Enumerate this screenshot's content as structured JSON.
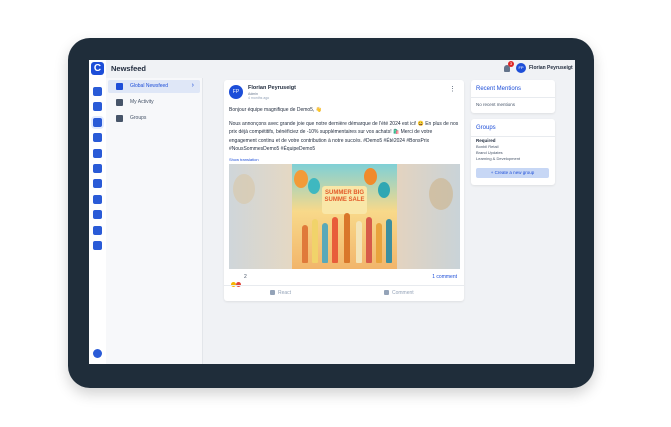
{
  "header": {
    "title": "Newsfeed",
    "notification_count": "3",
    "user_initials": "FP",
    "user_name": "Florian Peyruseigt"
  },
  "rail": {
    "logo": "C",
    "icons": [
      "home-icon",
      "chart-icon",
      "activity-icon",
      "calendar-icon",
      "book-icon",
      "image-icon",
      "folder-icon",
      "network-icon",
      "inbox-icon",
      "settings-icon",
      "users-icon"
    ]
  },
  "subnav": {
    "items": [
      {
        "label": "Global Newsfeed",
        "icon": "home-icon",
        "active": true
      },
      {
        "label": "My Activity",
        "icon": "activity-icon",
        "active": false
      },
      {
        "label": "Groups",
        "icon": "groups-icon",
        "active": false
      }
    ]
  },
  "post": {
    "author_initials": "FP",
    "author": "Florian Peyruseigt",
    "role": "Admin",
    "time": "4 months ago",
    "greeting": "Bonjour équipe magnifique de Demo5, 👋",
    "body": "Nous annonçons avec grande joie que notre dernière démarque de l'été 2024 est ici! 😀 En plus de nos prix déjà compétitifs, bénéficiez de -10% supplémentaires sur vos achats! 🛍️ Merci de votre engagement continu et de votre contribution à notre succès. #Demo5 #Été2024 #BonsPrix #NousSommesDemo5 #ÉquipeDemo5",
    "show_translation": "Show translation",
    "image_banner": "SUMMER BIG SUMME SALE",
    "reaction_count": "2",
    "comment_count": "1 comment",
    "react_label": "React",
    "comment_label": "Comment"
  },
  "mentions": {
    "title": "Recent Mentions",
    "empty_text": "No recent mentions"
  },
  "groups": {
    "title": "Groups",
    "required_label": "Required",
    "items": [
      "Bonbil Retail",
      "Brand Updates",
      "Learning & Development"
    ],
    "create_label": "+ Create a new group"
  },
  "colors": {
    "accent": "#1d4ed8",
    "device_frame": "#1f2d3a",
    "badge": "#dc2626"
  }
}
